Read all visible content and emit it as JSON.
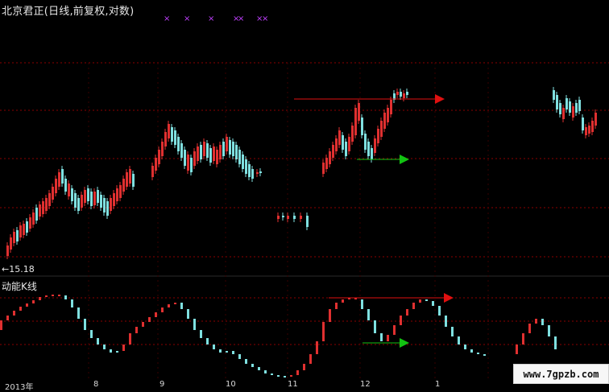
{
  "title": "北京君正(日线,前复权,对数)",
  "price_label": "←15.18",
  "indicator_title": "动能K线",
  "time_axis": [
    "2013年",
    "8",
    "9",
    "10",
    "11",
    "12",
    "1"
  ],
  "watermark": "www.7gpzb.com",
  "colors": {
    "background": "#000000",
    "grid_red": "#8b0000",
    "candle_up": "#e03030",
    "candle_down": "#7fe0e0",
    "arrow_red": "#e01010",
    "arrow_green": "#12c212",
    "marker_magenta": "#c040ff"
  },
  "top_markers": [
    "×",
    "×",
    "×",
    "×",
    "×",
    "×",
    "×"
  ]
}
